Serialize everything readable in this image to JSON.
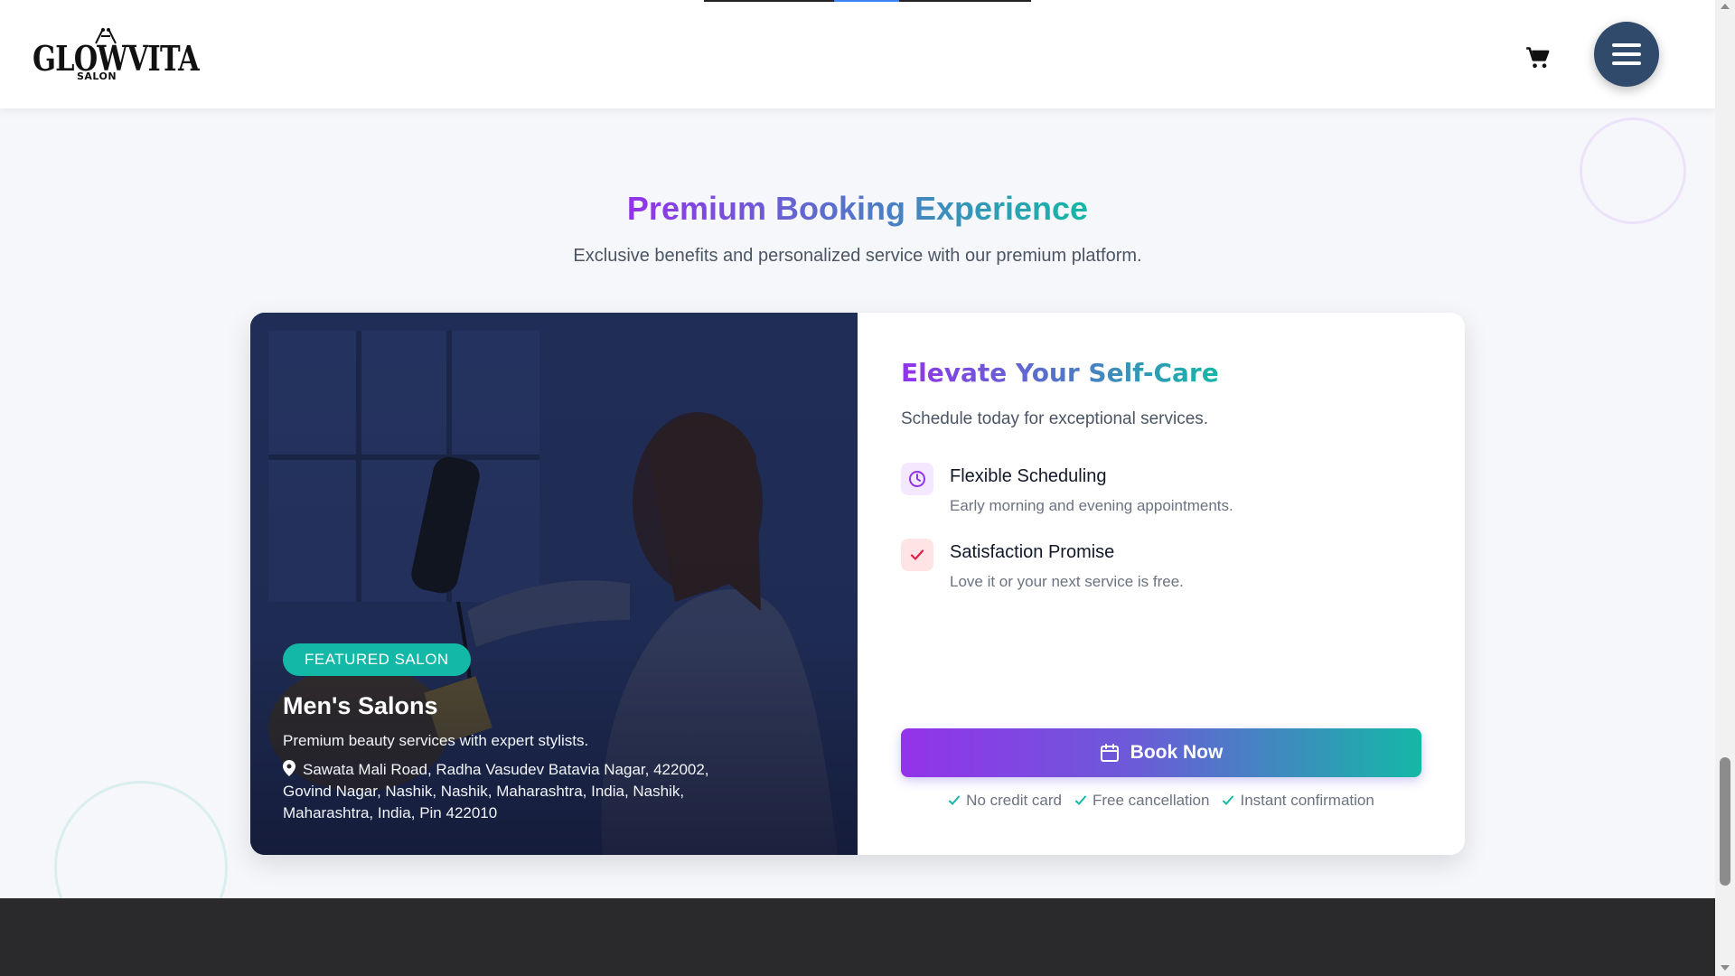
{
  "header": {
    "logo_text": "GLOWVITA",
    "logo_sub": "SALON",
    "cart_icon": "cart-icon",
    "menu_icon": "hamburger-menu-icon"
  },
  "section": {
    "title": "Premium Booking Experience",
    "subtitle": "Exclusive benefits and personalized service with our premium platform."
  },
  "featured": {
    "badge": "FEATURED SALON",
    "name": "Men's Salons",
    "description": "Premium beauty services with expert stylists.",
    "address": "Sawata Mali Road, Radha Vasudev Batavia Nagar, 422002, Govind Nagar, Nashik, Nashik, Maharashtra, India, Nashik, Maharashtra, India, Pin 422010"
  },
  "panel": {
    "title": "Elevate Your Self-Care",
    "subtitle": "Schedule today for exceptional services.",
    "features": [
      {
        "title": "Flexible Scheduling",
        "desc": "Early morning and evening appointments.",
        "icon": "clock-icon",
        "color": "#9333ea"
      },
      {
        "title": "Satisfaction Promise",
        "desc": "Love it or your next service is free.",
        "icon": "check-icon",
        "color": "#e11d48"
      }
    ],
    "cta": "Book Now",
    "perks": [
      "No credit card",
      "Free cancellation",
      "Instant confirmation"
    ]
  },
  "colors": {
    "gradient_start": "#9333ea",
    "gradient_end": "#14b8a6",
    "menu_button": "#2f4a6b",
    "footer": "#2a2a2c"
  }
}
